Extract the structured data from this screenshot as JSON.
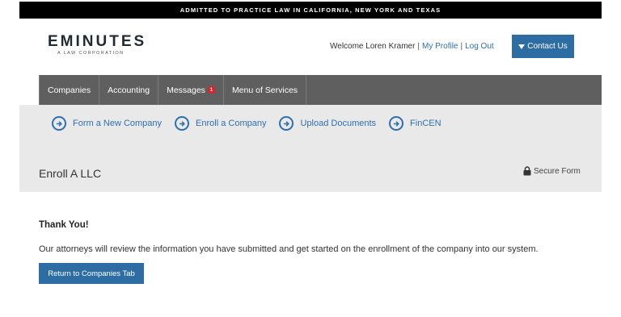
{
  "top_banner": "ADMITTED TO PRACTICE LAW IN CALIFORNIA, NEW YORK AND TEXAS",
  "logo": {
    "name": "EMINUTES",
    "tagline": "A LAW CORPORATION"
  },
  "header": {
    "welcome_text": "Welcome Loren Kramer",
    "my_profile": "My Profile",
    "log_out": "Log Out",
    "contact_button": "Contact Us"
  },
  "nav": {
    "items": [
      {
        "label": "Companies"
      },
      {
        "label": "Accounting"
      },
      {
        "label": "Messages",
        "badge": "1"
      },
      {
        "label": "Menu of Services"
      }
    ]
  },
  "quick_links": [
    {
      "label": "Form a New Company"
    },
    {
      "label": "Enroll a Company"
    },
    {
      "label": "Upload Documents"
    },
    {
      "label": "FinCEN"
    }
  ],
  "page": {
    "title": "Enroll A LLC",
    "secure_label": "Secure Form"
  },
  "content": {
    "heading": "Thank You!",
    "message": "Our attorneys will review the information you have submitted and get started on the enrollment of the company into our system.",
    "button": "Return to Companies Tab"
  },
  "colors": {
    "accent": "#2e6da4",
    "nav_bg": "#5f5f5f",
    "badge": "#d8262f",
    "panel_bg": "#e9e9e9"
  }
}
